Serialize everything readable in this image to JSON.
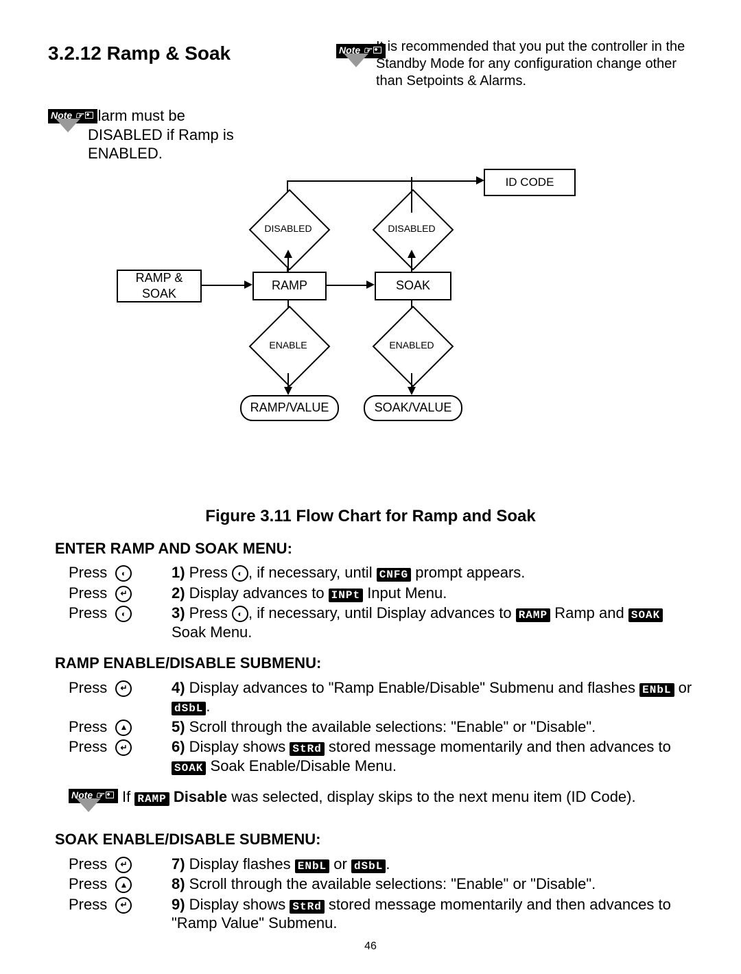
{
  "page_number": "46",
  "heading": "3.2.12 Ramp & Soak",
  "note_label": "Note ☞",
  "top_note_right": "It is recommended that you put the controller in the Standby Mode for any configuration change other than Setpoints & Alarms.",
  "top_note_left": "Alarm must be DISABLED if Ramp is ENABLED.",
  "flow": {
    "id_code": "ID CODE",
    "disabled1": "DISABLED",
    "disabled2": "DISABLED",
    "ramp_soak": "RAMP & SOAK",
    "ramp": "RAMP",
    "soak": "SOAK",
    "enable": "ENABLE",
    "enabled": "ENABLED",
    "ramp_value": "RAMP/VALUE",
    "soak_value": "SOAK/VALUE"
  },
  "figure_caption": "Figure 3.11 Flow Chart for Ramp and Soak",
  "sections": {
    "enter": "ENTER RAMP AND SOAK MENU:",
    "ramp_sub": "RAMP ENABLE/DISABLE SUBMENU:",
    "soak_sub": "SOAK ENABLE/DISABLE SUBMENU:"
  },
  "press": "Press",
  "btn_menu": "◐",
  "btn_enter": "↵",
  "btn_up": "▲",
  "seg": {
    "cnfg": "CNFG",
    "inpt": "INPt",
    "ramp": "RAMP",
    "soak": "SOAK",
    "enbl": "ENbL",
    "dsbl": "dSbL",
    "strd": "StRd"
  },
  "steps": {
    "s1a": "1)",
    "s1b": " Press ",
    "s1c": ", if necessary, until ",
    "s1d": " prompt appears.",
    "s2a": "2)",
    "s2b": " Display advances to ",
    "s2c": " Input Menu.",
    "s3a": "3)",
    "s3b": " Press ",
    "s3c": ", if necessary, until Display advances to ",
    "s3d": " Ramp and ",
    "s3e": " Soak Menu.",
    "s4a": "4)",
    "s4b": " Display advances to \"Ramp Enable/Disable\" Submenu and flashes ",
    "s4or": " or ",
    "s4c": ".",
    "s5a": "5)",
    "s5b": " Scroll through the available selections: \"Enable\" or \"Disable\".",
    "s6a": "6)",
    "s6b": " Display shows ",
    "s6c": " stored message momentarily and then advances to ",
    "s6d": " Soak Enable/Disable Menu.",
    "note_mid_a": "If ",
    "note_mid_b": " Disable",
    "note_mid_c": " was selected, display skips to the next menu item (ID Code).",
    "s7a": "7)",
    "s7b": " Display flashes ",
    "s7or": " or ",
    "s7c": ".",
    "s8a": "8)",
    "s8b": " Scroll through the available selections: \"Enable\" or \"Disable\".",
    "s9a": "9)",
    "s9b": " Display shows ",
    "s9c": " stored message momentarily and then advances to \"Ramp Value\" Submenu."
  }
}
